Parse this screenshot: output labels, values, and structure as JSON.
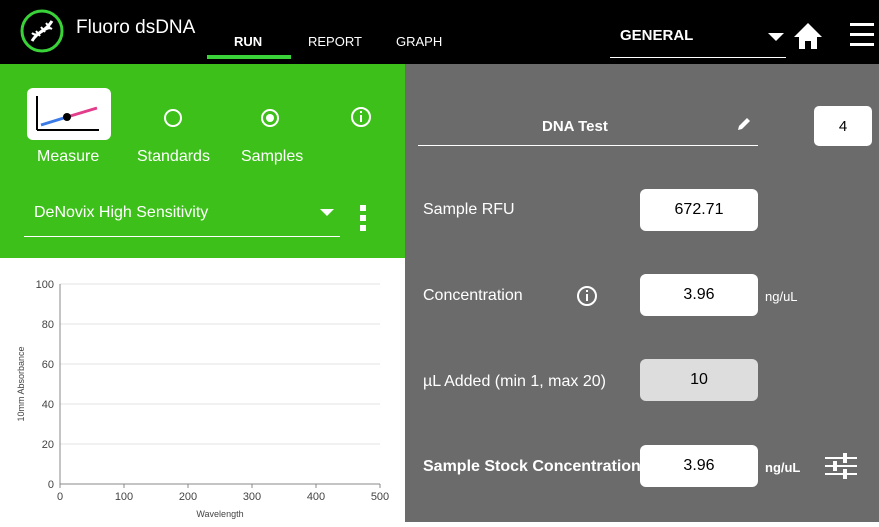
{
  "app": {
    "title": "Fluoro dsDNA"
  },
  "nav": {
    "tabs": [
      {
        "label": "RUN"
      },
      {
        "label": "REPORT"
      },
      {
        "label": "GRAPH"
      }
    ],
    "protocol": "GENERAL"
  },
  "left": {
    "modes": [
      {
        "label": "Measure"
      },
      {
        "label": "Standards"
      },
      {
        "label": "Samples"
      }
    ],
    "assay": "DeNovix High Sensitivity"
  },
  "right": {
    "test_name": "DNA Test",
    "sample_number": "4",
    "rows": {
      "sample_rfu": {
        "label": "Sample RFU",
        "value": "672.71"
      },
      "concentration": {
        "label": "Concentration",
        "value": "3.96",
        "unit": "ng/uL"
      },
      "ul_added": {
        "label": "µL Added (min 1, max 20)",
        "value": "10"
      },
      "stock": {
        "label": "Sample Stock Concentration",
        "value": "3.96",
        "unit": "ng/uL"
      }
    }
  },
  "chart_data": {
    "type": "line",
    "xlabel": "Wavelength",
    "ylabel": "10mm Absorbance",
    "xlim": [
      0,
      500
    ],
    "ylim": [
      0,
      100
    ],
    "xticks": [
      "0",
      "100",
      "200",
      "300",
      "400",
      "500"
    ],
    "yticks": [
      "0",
      "20",
      "40",
      "60",
      "80",
      "100"
    ],
    "series": [],
    "grid": true
  }
}
